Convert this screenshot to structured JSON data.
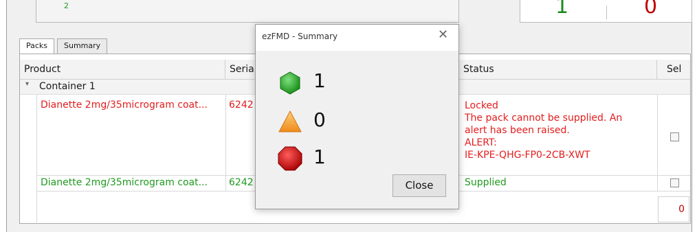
{
  "top": {
    "partial_number": "2",
    "green_count": "1",
    "red_count": "0"
  },
  "tabs": [
    {
      "label": "Packs",
      "active": true
    },
    {
      "label": "Summary",
      "active": false
    }
  ],
  "grid": {
    "columns": [
      "Product",
      "Seria",
      "Status",
      "Sel"
    ],
    "group_label": "Container 1",
    "rows": [
      {
        "product": "Dianette 2mg/35microgram coat...",
        "serial": "6242",
        "status_lines": [
          "Locked",
          "The pack cannot be supplied. An",
          "alert has been raised.",
          "ALERT:",
          "IE-KPE-QHG-FP0-2CB-XWT"
        ],
        "color": "red"
      },
      {
        "product": "Dianette 2mg/35microgram coat...",
        "serial": "6242",
        "status_lines": [
          "Supplied"
        ],
        "color": "green"
      }
    ],
    "footer_count": "0"
  },
  "dialog": {
    "title": "ezFMD - Summary",
    "close_glyph": "✕",
    "green_count": "1",
    "orange_count": "0",
    "red_count": "1",
    "close_button": "Close"
  },
  "colors": {
    "red_text": "#e31c1c",
    "green_text": "#1e9a1e",
    "accent_green": "#1f9e1f",
    "accent_orange": "#f39a2a",
    "accent_red": "#c40000"
  }
}
